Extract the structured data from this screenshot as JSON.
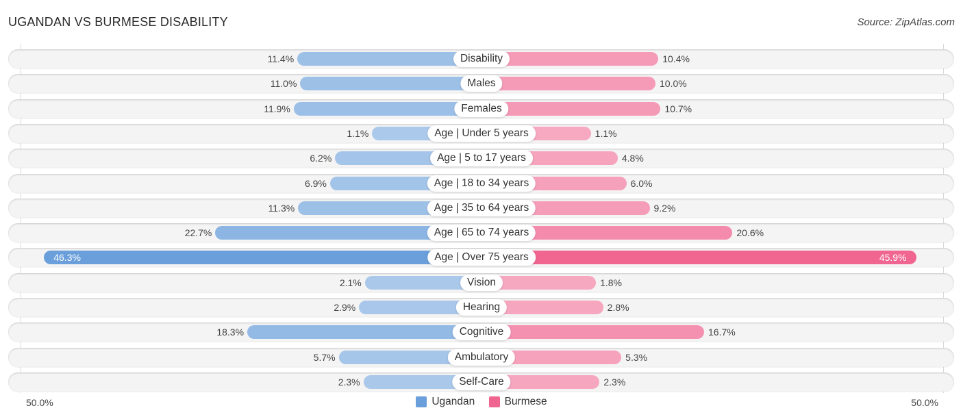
{
  "chart_data": {
    "type": "bar",
    "orientation": "horizontal-diverging",
    "title": "UGANDAN VS BURMESE DISABILITY",
    "source": "Source: ZipAtlas.com",
    "categories": [
      "Disability",
      "Males",
      "Females",
      "Age | Under 5 years",
      "Age | 5 to 17 years",
      "Age | 18 to 34 years",
      "Age | 35 to 64 years",
      "Age | 65 to 74 years",
      "Age | Over 75 years",
      "Vision",
      "Hearing",
      "Cognitive",
      "Ambulatory",
      "Self-Care"
    ],
    "series": [
      {
        "name": "Ugandan",
        "side": "left",
        "color": "#6a9fdb",
        "values": [
          11.4,
          11.0,
          11.9,
          1.1,
          6.2,
          6.9,
          11.3,
          22.7,
          46.3,
          2.1,
          2.9,
          18.3,
          5.7,
          2.3
        ],
        "labels": [
          "11.4%",
          "11.0%",
          "11.9%",
          "1.1%",
          "6.2%",
          "6.9%",
          "11.3%",
          "22.7%",
          "46.3%",
          "2.1%",
          "2.9%",
          "18.3%",
          "5.7%",
          "2.3%"
        ]
      },
      {
        "name": "Burmese",
        "side": "right",
        "color": "#f06590",
        "values": [
          10.4,
          10.0,
          10.7,
          1.1,
          4.8,
          6.0,
          9.2,
          20.6,
          45.9,
          1.8,
          2.8,
          16.7,
          5.3,
          2.3
        ],
        "labels": [
          "10.4%",
          "10.0%",
          "10.7%",
          "1.1%",
          "4.8%",
          "6.0%",
          "9.2%",
          "20.6%",
          "45.9%",
          "1.8%",
          "2.8%",
          "16.7%",
          "5.3%",
          "2.3%"
        ]
      }
    ],
    "xlim": [
      -50,
      50
    ],
    "axis_labels": {
      "left": "50.0%",
      "right": "50.0%"
    },
    "legend": {
      "position": "bottom-center",
      "items": [
        {
          "name": "Ugandan",
          "color": "#6a9fdb"
        },
        {
          "name": "Burmese",
          "color": "#f06590"
        }
      ]
    },
    "grid": false
  }
}
